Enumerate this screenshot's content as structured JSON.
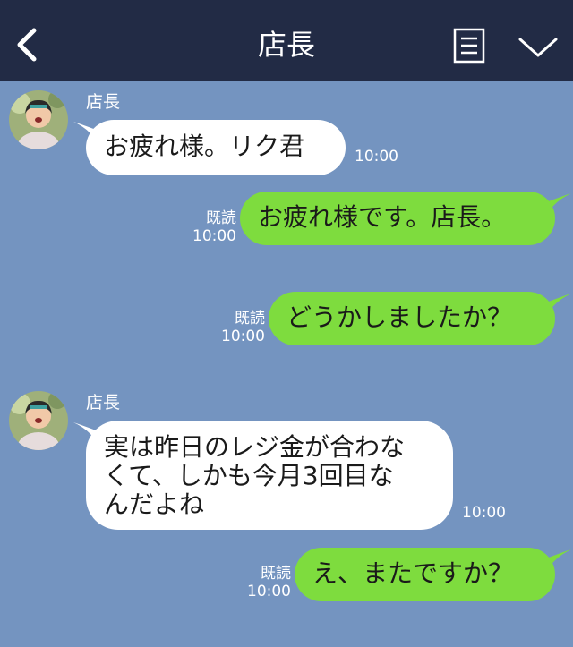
{
  "header": {
    "title": "店長",
    "back_icon": "chevron-left-icon",
    "menu_icon": "menu-list-icon",
    "expand_icon": "chevron-down-icon"
  },
  "messages": [
    {
      "direction": "in",
      "sender": "店長",
      "text": "お疲れ様。リク君",
      "time": "10:00"
    },
    {
      "direction": "out",
      "read": "既読",
      "text": "お疲れ様です。店長。",
      "time": "10:00"
    },
    {
      "direction": "out",
      "read": "既読",
      "text": "どうかしましたか？",
      "time": "10:00"
    },
    {
      "direction": "in",
      "sender": "店長",
      "text": "実は昨日のレジ金が合わな\nくて、しかも今月3回目な\nんだよね",
      "time": "10:00"
    },
    {
      "direction": "out",
      "read": "既読",
      "text": "え、またですか？",
      "time": "10:00"
    }
  ],
  "colors": {
    "header_bg": "#222b45",
    "chat_bg": "#7494c0",
    "incoming_bubble": "#ffffff",
    "outgoing_bubble": "#7edc3e"
  }
}
